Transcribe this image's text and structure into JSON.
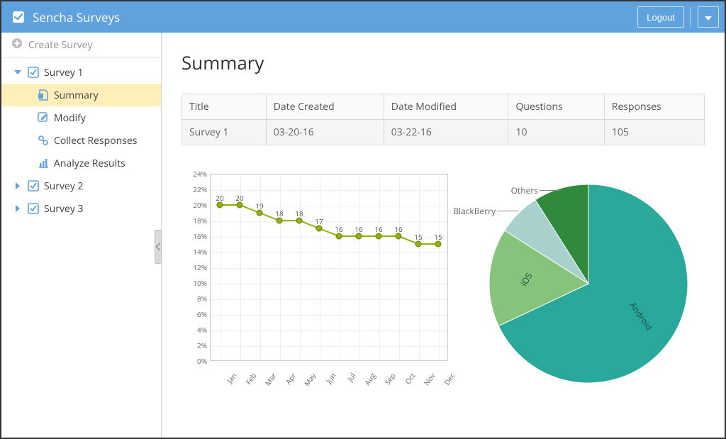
{
  "header": {
    "title": "Sencha Surveys",
    "logout_label": "Logout"
  },
  "sidebar": {
    "create_label": "Create Survey",
    "items": [
      {
        "label": "Survey 1",
        "expanded": true
      },
      {
        "label": "Survey 2",
        "expanded": false
      },
      {
        "label": "Survey 3",
        "expanded": false
      }
    ],
    "survey1_children": [
      {
        "label": "Summary",
        "icon": "summary-icon",
        "selected": true
      },
      {
        "label": "Modify",
        "icon": "modify-icon",
        "selected": false
      },
      {
        "label": "Collect Responses",
        "icon": "collect-icon",
        "selected": false
      },
      {
        "label": "Analyze Results",
        "icon": "analyze-icon",
        "selected": false
      }
    ]
  },
  "main": {
    "title": "Summary",
    "table": {
      "headers": [
        "Title",
        "Date Created",
        "Date Modified",
        "Questions",
        "Responses"
      ],
      "row": [
        "Survey 1",
        "03-20-16",
        "03-22-16",
        "10",
        "105"
      ]
    }
  },
  "chart_data": [
    {
      "type": "line",
      "categories": [
        "Jan",
        "Feb",
        "Mar",
        "Apr",
        "May",
        "Jun",
        "Jul",
        "Aug",
        "Sep",
        "Oct",
        "Nov",
        "Dec"
      ],
      "values": [
        20,
        20,
        19,
        18,
        18,
        17,
        16,
        16,
        16,
        16,
        15,
        15
      ],
      "ylabel": "",
      "xlabel": "",
      "ylim": [
        0,
        24
      ],
      "ystep": 2,
      "yunit": "%",
      "color": "#94ae0a"
    },
    {
      "type": "pie",
      "series": [
        {
          "name": "Android",
          "value": 68,
          "color": "#2aa89c"
        },
        {
          "name": "iOS",
          "value": 16,
          "color": "#86c47b"
        },
        {
          "name": "BlackBerry",
          "value": 7,
          "color": "#a8d0cc"
        },
        {
          "name": "Others",
          "value": 9,
          "color": "#2f8a3b"
        }
      ]
    }
  ]
}
